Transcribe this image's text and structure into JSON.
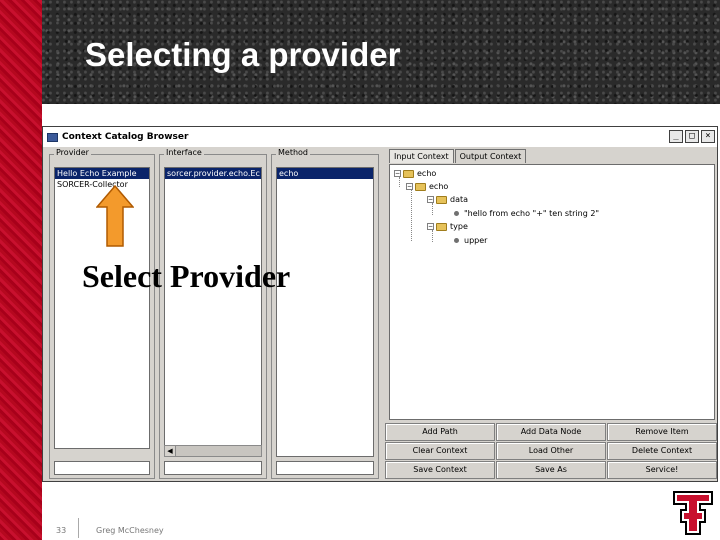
{
  "slide": {
    "title": "Selecting a provider",
    "page_number": "33",
    "author": "Greg McChesney",
    "annotation_label": "Select Provider"
  },
  "window": {
    "title": "Context Catalog Browser",
    "buttons": [
      "_",
      "□",
      "×"
    ]
  },
  "provider_panel": {
    "label": "Provider",
    "items": [
      "Hello Echo Example",
      "SORCER-Collector"
    ],
    "selected_index": 0
  },
  "interface_panel": {
    "label": "Interface",
    "items": [
      "sorcer.provider.echo.Ec"
    ],
    "selected_index": 0
  },
  "method_panel": {
    "label": "Method",
    "items": [
      "echo"
    ],
    "selected_index": 0
  },
  "tabs": [
    "Input Context",
    "Output Context"
  ],
  "tree": {
    "root": "echo",
    "child": "echo",
    "data_node": "data",
    "data_value": "\"hello from echo \"+\" ten string 2\"",
    "type_node": "type",
    "type_value": "upper"
  },
  "buttons": [
    "Add Path",
    "Add Data Node",
    "Remove Item",
    "Clear Context",
    "Load Other",
    "Delete Context",
    "Save Context",
    "Save As",
    "Service!"
  ],
  "colors": {
    "accent_red": "#c8102e",
    "selection_blue": "#0a246a",
    "arrow_fill": "#f39a2c"
  },
  "icons": {
    "arrow": "up-arrow-icon",
    "logo": "texas-tech-logo"
  }
}
